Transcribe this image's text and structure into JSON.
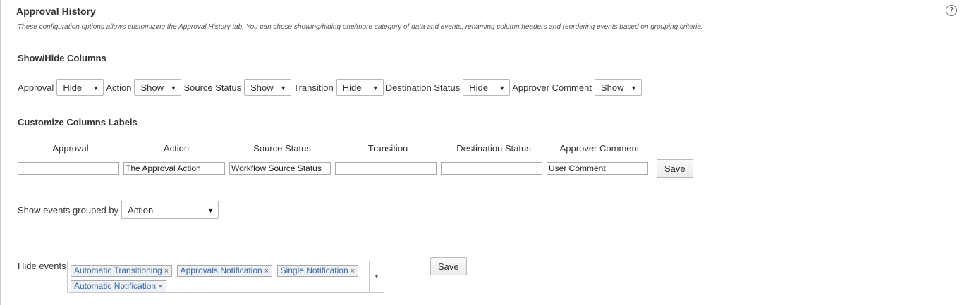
{
  "header": {
    "title": "Approval History",
    "help_icon": "?",
    "description": "These configuration options allows customizing the Approval History tab. You can chose showing/hiding one/more category of data and events, renaming column headers and reordering events based on grouping criteria."
  },
  "show_hide": {
    "title": "Show/Hide Columns",
    "columns": [
      {
        "label": "Approval",
        "value": "Hide"
      },
      {
        "label": "Action",
        "value": "Show"
      },
      {
        "label": "Source Status",
        "value": "Show"
      },
      {
        "label": "Transition",
        "value": "Hide"
      },
      {
        "label": "Destination Status",
        "value": "Hide"
      },
      {
        "label": "Approver Comment",
        "value": "Show"
      }
    ],
    "arrow": "▼"
  },
  "customize": {
    "title": "Customize Columns Labels",
    "headers": [
      "Approval",
      "Action",
      "Source Status",
      "Transition",
      "Destination Status",
      "Approver Comment"
    ],
    "values": [
      "",
      "The Approval Action",
      "Workflow Source Status",
      "",
      "",
      "User Comment"
    ],
    "save_label": "Save"
  },
  "grouping": {
    "label": "Show events grouped by",
    "value": "Action"
  },
  "hide_events": {
    "label": "Hide events",
    "chips": [
      "Automatic Transitioning",
      "Approvals Notification",
      "Single Notification",
      "Automatic Notification"
    ],
    "remove_glyph": "×",
    "save_label": "Save"
  }
}
